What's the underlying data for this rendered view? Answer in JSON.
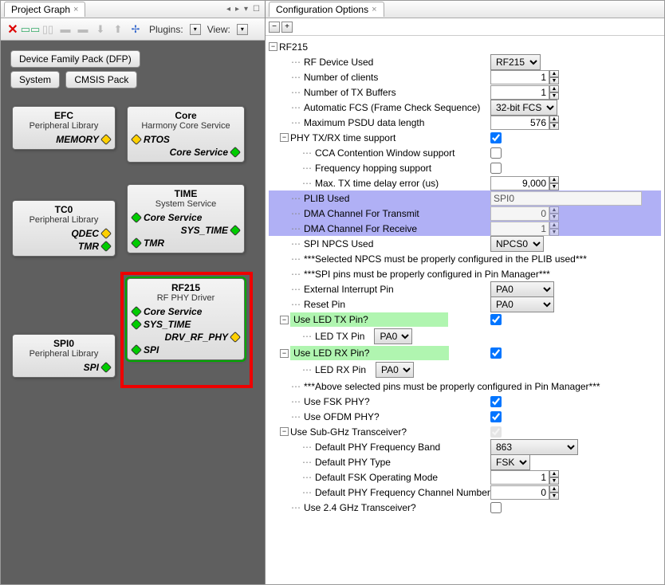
{
  "tabs": {
    "left": "Project Graph",
    "right": "Configuration Options"
  },
  "toolbar": {
    "plugins": "Plugins:",
    "view": "View:"
  },
  "chips": {
    "dfp": "Device Family Pack (DFP)",
    "system": "System",
    "cmsis": "CMSIS Pack"
  },
  "nodes": {
    "efc": {
      "title": "EFC",
      "sub": "Peripheral Library",
      "p1": "MEMORY"
    },
    "core": {
      "title": "Core",
      "sub": "Harmony Core Service",
      "p1": "RTOS",
      "p2": "Core Service"
    },
    "tc0": {
      "title": "TC0",
      "sub": "Peripheral Library",
      "p1": "QDEC",
      "p2": "TMR"
    },
    "time": {
      "title": "TIME",
      "sub": "System Service",
      "p1": "Core Service",
      "p2": "SYS_TIME",
      "p3": "TMR"
    },
    "spi0": {
      "title": "SPI0",
      "sub": "Peripheral Library",
      "p1": "SPI"
    },
    "rf215": {
      "title": "RF215",
      "sub": "RF PHY Driver",
      "p1": "Core Service",
      "p2": "SYS_TIME",
      "p3": "DRV_RF_PHY",
      "p4": "SPI"
    }
  },
  "cfg": {
    "root": "RF215",
    "rfDeviceLbl": "RF Device Used",
    "rfDevice": "RF215",
    "numClientsLbl": "Number of clients",
    "numClients": "1",
    "numTxBufLbl": "Number of TX Buffers",
    "numTxBuf": "1",
    "autoFcsLbl": "Automatic FCS (Frame Check Sequence)",
    "autoFcs": "32-bit FCS",
    "maxPsduLbl": "Maximum PSDU data length",
    "maxPsdu": "576",
    "phySupportLbl": "PHY TX/RX time support",
    "ccaLbl": "CCA Contention Window support",
    "freqHopLbl": "Frequency hopping support",
    "maxTxDelayLbl": "Max. TX time delay error (us)",
    "maxTxDelay": "9,000",
    "plibUsedLbl": "PLIB Used",
    "plibUsed": "SPI0",
    "dmaTxLbl": "DMA Channel For Transmit",
    "dmaTx": "0",
    "dmaRxLbl": "DMA Channel For Receive",
    "dmaRx": "1",
    "npcsLbl": "SPI NPCS Used",
    "npcs": "NPCS0",
    "noteNpcs": "***Selected NPCS must be properly configured in the PLIB used***",
    "noteSpiPins": "***SPI pins must be properly configured in Pin Manager***",
    "extIntLbl": "External Interrupt Pin",
    "extInt": "PA0",
    "resetPinLbl": "Reset Pin",
    "resetPin": "PA0",
    "useLedTxLbl": "Use LED TX Pin?",
    "ledTxPinLbl": "LED TX Pin",
    "ledTxPin": "PA0",
    "useLedRxLbl": "Use LED RX Pin?",
    "ledRxPinLbl": "LED RX Pin",
    "ledRxPin": "PA0",
    "notePins": "***Above selected pins must be properly configured in Pin Manager***",
    "useFskLbl": "Use FSK PHY?",
    "useOfdmLbl": "Use OFDM PHY?",
    "useSubGhzLbl": "Use Sub-GHz Transceiver?",
    "defBandLbl": "Default PHY Frequency Band",
    "defBand": "863",
    "defTypeLbl": "Default PHY Type",
    "defType": "FSK",
    "defFskModeLbl": "Default FSK Operating Mode",
    "defFskMode": "1",
    "defChanLbl": "Default PHY Frequency Channel Number",
    "defChan": "0",
    "use24Lbl": "Use 2.4 GHz Transceiver?"
  }
}
